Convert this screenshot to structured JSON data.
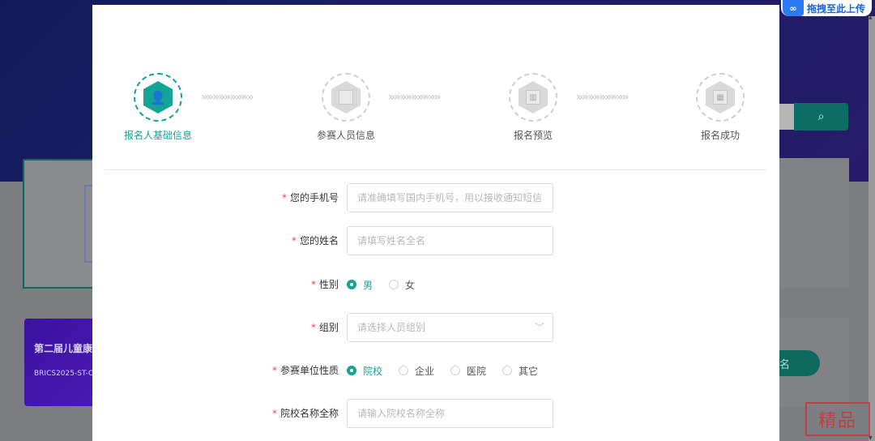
{
  "background": {
    "event_title": "第二届儿童康",
    "event_code": "BRICS2025-ST-C",
    "signup_button": "名",
    "search_icon": "search-icon",
    "upload_pill": "拖拽至此上传",
    "watermark": "精品"
  },
  "steps": [
    {
      "label": "报名人基础信息",
      "icon": "user-gear-icon",
      "active": true
    },
    {
      "label": "参赛人员信息",
      "icon": "document-icon",
      "active": false
    },
    {
      "label": "报名预览",
      "icon": "chart-doc-icon",
      "active": false
    },
    {
      "label": "报名成功",
      "icon": "calendar-check-icon",
      "active": false
    }
  ],
  "arrows": "»»»»»»»»»",
  "form": {
    "phone": {
      "label": "您的手机号",
      "placeholder": "请准确填写国内手机号，用以接收通知短信"
    },
    "name": {
      "label": "您的姓名",
      "placeholder": "请填写姓名全名"
    },
    "gender": {
      "label": "性别",
      "options": [
        "男",
        "女"
      ],
      "selected": "男"
    },
    "group": {
      "label": "组别",
      "placeholder": "请选择人员组别"
    },
    "unit_type": {
      "label": "参赛单位性质",
      "options": [
        "院校",
        "企业",
        "医院",
        "其它"
      ],
      "selected": "院校"
    },
    "school_name": {
      "label": "院校名称全称",
      "placeholder": "请输入院校名称全称"
    }
  },
  "required_mark": "*",
  "colors": {
    "accent": "#14a395",
    "required": "#f0473f"
  }
}
